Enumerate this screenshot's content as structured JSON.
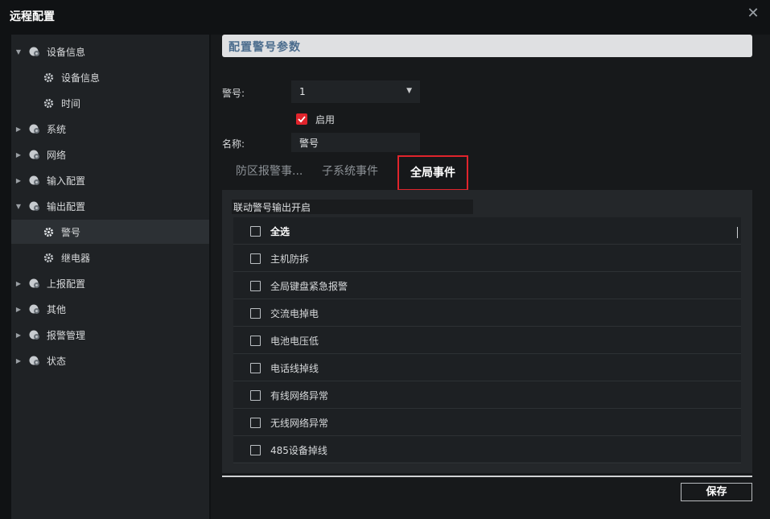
{
  "window": {
    "title": "远程配置"
  },
  "sidebar": {
    "items": [
      {
        "label": "设备信息",
        "level": 0,
        "expanded": true
      },
      {
        "label": "设备信息",
        "level": 1
      },
      {
        "label": "时间",
        "level": 1
      },
      {
        "label": "系统",
        "level": 0,
        "expanded": false
      },
      {
        "label": "网络",
        "level": 0,
        "expanded": false
      },
      {
        "label": "输入配置",
        "level": 0,
        "expanded": false
      },
      {
        "label": "输出配置",
        "level": 0,
        "expanded": true
      },
      {
        "label": "警号",
        "level": 1,
        "selected": true
      },
      {
        "label": "继电器",
        "level": 1
      },
      {
        "label": "上报配置",
        "level": 0,
        "expanded": false
      },
      {
        "label": "其他",
        "level": 0,
        "expanded": false
      },
      {
        "label": "报警管理",
        "level": 0,
        "expanded": false
      },
      {
        "label": "状态",
        "level": 0,
        "expanded": false
      }
    ]
  },
  "main": {
    "header": "配置警号参数",
    "siren_label": "警号:",
    "siren_value": "1",
    "enable_label": "启用",
    "enable_checked": true,
    "name_label": "名称:",
    "name_value": "警号",
    "tabs": [
      {
        "label": "防区报警事...",
        "active": false
      },
      {
        "label": "子系统事件",
        "active": false
      },
      {
        "label": "全局事件",
        "active": true
      }
    ],
    "linkage_label": "联动警号输出开启",
    "select_all": "全选",
    "events": [
      "主机防拆",
      "全局键盘紧急报警",
      "交流电掉电",
      "电池电压低",
      "电话线掉线",
      "有线网络异常",
      "无线网络异常",
      "485设备掉线"
    ],
    "save_label": "保存"
  },
  "colors": {
    "accent": "#e0242c",
    "header_text": "#4b6c8d"
  }
}
